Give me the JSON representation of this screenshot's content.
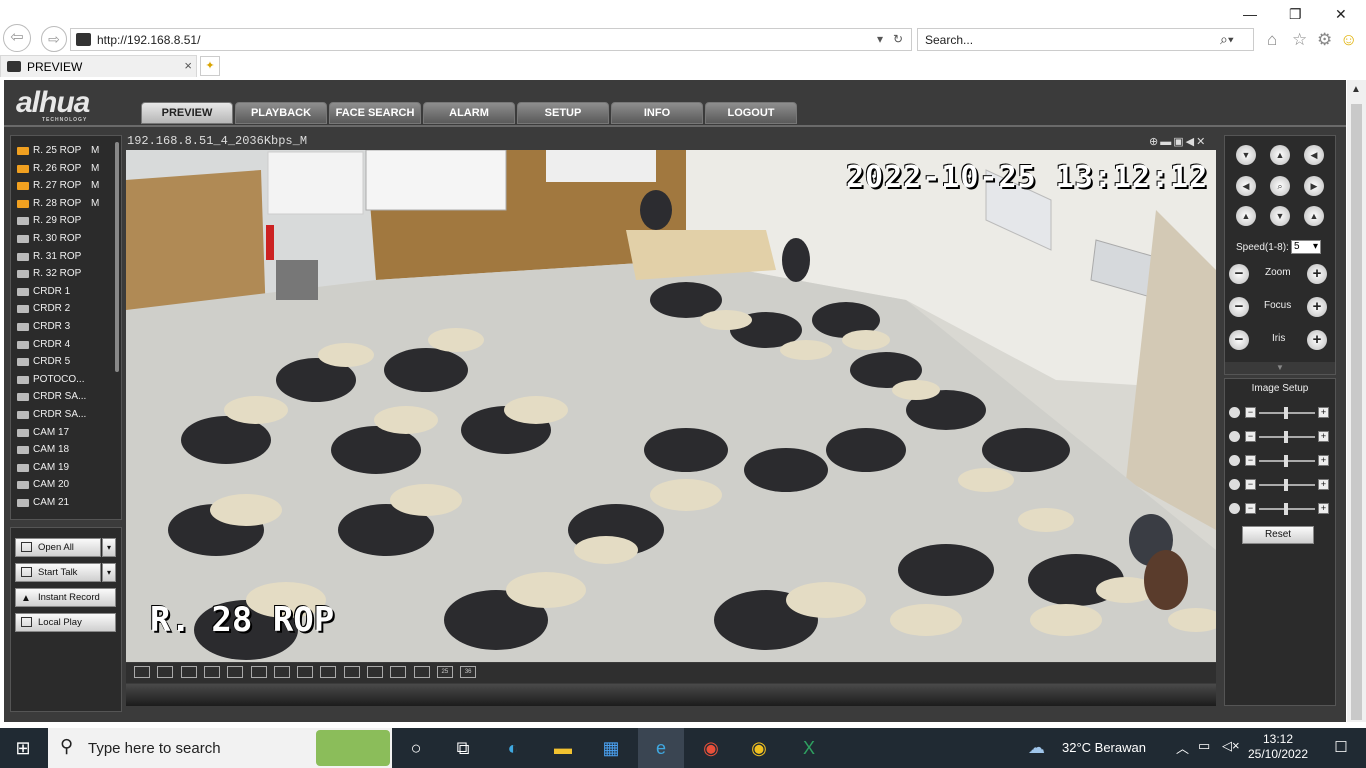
{
  "browser": {
    "url": "http://192.168.8.51/",
    "search_placeholder": "Search...",
    "tab_title": "PREVIEW",
    "tab_close": "×",
    "window_controls": [
      "—",
      "❐",
      "✕"
    ]
  },
  "app": {
    "logo": "alhua",
    "logo_sub": "TECHNOLOGY",
    "menu": [
      "PREVIEW",
      "PLAYBACK",
      "FACE SEARCH",
      "ALARM",
      "SETUP",
      "INFO",
      "LOGOUT"
    ],
    "active_menu": "PREVIEW",
    "channels": [
      {
        "name": "R. 25 ROP",
        "flag": "M",
        "live": true
      },
      {
        "name": "R. 26 ROP",
        "flag": "M",
        "live": true
      },
      {
        "name": "R. 27 ROP",
        "flag": "M",
        "live": true
      },
      {
        "name": "R. 28 ROP",
        "flag": "M",
        "live": true
      },
      {
        "name": "R. 29 ROP",
        "flag": "",
        "live": false
      },
      {
        "name": "R. 30 ROP",
        "flag": "",
        "live": false
      },
      {
        "name": "R. 31 ROP",
        "flag": "",
        "live": false
      },
      {
        "name": "R. 32 ROP",
        "flag": "",
        "live": false
      },
      {
        "name": "CRDR 1",
        "flag": "",
        "live": false
      },
      {
        "name": "CRDR 2",
        "flag": "",
        "live": false
      },
      {
        "name": "CRDR 3",
        "flag": "",
        "live": false
      },
      {
        "name": "CRDR 4",
        "flag": "",
        "live": false
      },
      {
        "name": "CRDR 5",
        "flag": "",
        "live": false
      },
      {
        "name": "POTOCO...",
        "flag": "",
        "live": false
      },
      {
        "name": "CRDR SA...",
        "flag": "",
        "live": false
      },
      {
        "name": "CRDR SA...",
        "flag": "",
        "live": false
      },
      {
        "name": "CAM 17",
        "flag": "",
        "live": false
      },
      {
        "name": "CAM 18",
        "flag": "",
        "live": false
      },
      {
        "name": "CAM 19",
        "flag": "",
        "live": false
      },
      {
        "name": "CAM 20",
        "flag": "",
        "live": false
      },
      {
        "name": "CAM 21",
        "flag": "",
        "live": false
      }
    ],
    "actions": {
      "open_all": "Open All",
      "start_talk": "Start Talk",
      "instant_record": "Instant Record",
      "local_play": "Local Play"
    },
    "video": {
      "title": "192.168.8.51_4_2036Kbps_M",
      "osd_time": "2022-10-25 13:12:12",
      "osd_name": "R. 28 ROP"
    },
    "layout_buttons": [
      "",
      "",
      "",
      "",
      "",
      "",
      "",
      "",
      "",
      "",
      "",
      "",
      "",
      "25",
      "36"
    ],
    "ptz": {
      "speed_label": "Speed(1-8):",
      "speed_value": "5",
      "zoom": "Zoom",
      "focus": "Focus",
      "iris": "Iris"
    },
    "image_setup": {
      "title": "Image Setup",
      "reset": "Reset",
      "sliders": [
        0.5,
        0.5,
        0.5,
        0.5,
        0.5
      ]
    }
  },
  "taskbar": {
    "search_placeholder": "Type here to search",
    "weather": "32°C  Berawan",
    "time": "13:12",
    "date": "25/10/2022"
  },
  "colors": {
    "app_bg": "#3b3b3b",
    "live_channel": "#f0a020",
    "taskbar": "#202a33"
  }
}
